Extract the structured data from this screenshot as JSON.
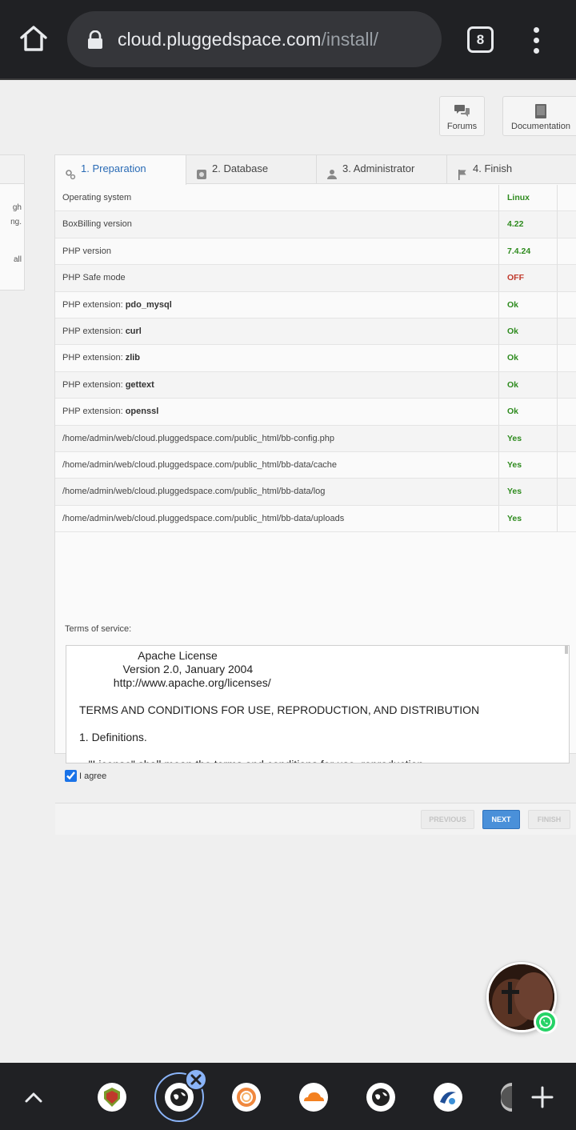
{
  "browser": {
    "url_host": "cloud.pluggedspace.com",
    "url_path": "/install/",
    "tab_count": "8"
  },
  "top_links": [
    {
      "label": "Forums",
      "icon": "chat-bubbles-icon"
    },
    {
      "label": "Documentation",
      "icon": "book-icon"
    }
  ],
  "side_panel_fragments": [
    "gh",
    "ng.",
    "all"
  ],
  "steps": [
    {
      "label": "1. Preparation",
      "icon": "gears-icon",
      "active": true
    },
    {
      "label": "2. Database",
      "icon": "database-icon",
      "active": false
    },
    {
      "label": "3. Administrator",
      "icon": "user-icon",
      "active": false
    },
    {
      "label": "4. Finish",
      "icon": "flag-icon",
      "active": false
    }
  ],
  "requirements": [
    {
      "prefix": "Operating system",
      "bold": "",
      "value": "Linux"
    },
    {
      "prefix": "BoxBilling version",
      "bold": "",
      "value": "4.22"
    },
    {
      "prefix": "PHP version",
      "bold": "",
      "value": "7.4.24"
    },
    {
      "prefix": "PHP Safe mode",
      "bold": "",
      "value": "OFF"
    },
    {
      "prefix": "PHP extension: ",
      "bold": "pdo_mysql",
      "value": "Ok"
    },
    {
      "prefix": "PHP extension: ",
      "bold": "curl",
      "value": "Ok"
    },
    {
      "prefix": "PHP extension: ",
      "bold": "zlib",
      "value": "Ok"
    },
    {
      "prefix": "PHP extension: ",
      "bold": "gettext",
      "value": "Ok"
    },
    {
      "prefix": "PHP extension: ",
      "bold": "openssl",
      "value": "Ok"
    },
    {
      "prefix": "/home/admin/web/cloud.pluggedspace.com/public_html/bb-config.php",
      "bold": "",
      "value": "Yes"
    },
    {
      "prefix": "/home/admin/web/cloud.pluggedspace.com/public_html/bb-data/cache",
      "bold": "",
      "value": "Yes"
    },
    {
      "prefix": "/home/admin/web/cloud.pluggedspace.com/public_html/bb-data/log",
      "bold": "",
      "value": "Yes"
    },
    {
      "prefix": "/home/admin/web/cloud.pluggedspace.com/public_html/bb-data/uploads",
      "bold": "",
      "value": "Yes"
    }
  ],
  "terms": {
    "label": "Terms of service:",
    "text": "                   Apache License\n              Version 2.0, January 2004\n           http://www.apache.org/licenses/\n\nTERMS AND CONDITIONS FOR USE, REPRODUCTION, AND DISTRIBUTION\n\n1. Definitions.\n\n   \"License\" shall mean the terms and conditions for use, reproduction,"
  },
  "agree_label": "I agree",
  "buttons": {
    "previous": "PREVIOUS",
    "next": "NEXT",
    "finish": "FINISH"
  },
  "colors": {
    "ok_green": "#2e8b1e",
    "accent_blue": "#4a90d9",
    "chrome_dark": "#202124"
  },
  "bottom_tabs": [
    "shield-icon",
    "globe-icon",
    "ring-icon",
    "cloudflare-icon",
    "globe-icon",
    "sail-icon",
    "partial-tab-icon"
  ]
}
